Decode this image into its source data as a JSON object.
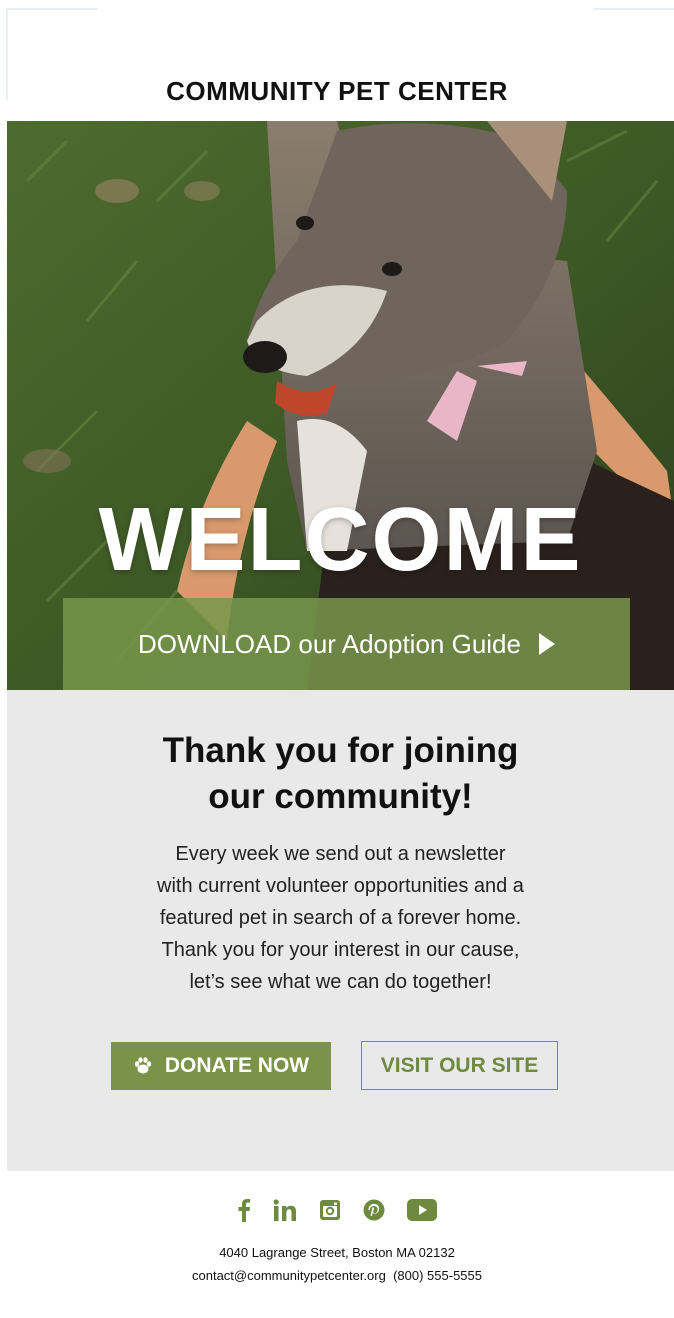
{
  "brand": {
    "title": "COMMUNITY PET CENTER"
  },
  "hero": {
    "welcome_text": "WELCOME",
    "download_text": "DOWNLOAD our Adoption Guide"
  },
  "content": {
    "headline_line1": "Thank you for joining",
    "headline_line2": "our community!",
    "body_lines": [
      "Every week we send out a newsletter",
      "with current volunteer opportunities and a",
      "featured pet in search of a forever home.",
      "Thank you for your interest in our cause,",
      "let’s see what we can do together!"
    ],
    "donate_label": "DONATE NOW",
    "visit_label": "VISIT OUR SITE"
  },
  "social": {
    "icons": [
      "facebook-icon",
      "linkedin-icon",
      "instagram-icon",
      "pinterest-icon",
      "youtube-icon"
    ]
  },
  "footer": {
    "address": "4040 Lagrange Street, Boston MA 02132",
    "email": "contact@communitypetcenter.org",
    "phone": "(800) 555-5555"
  },
  "colors": {
    "accent": "#7a9348",
    "panel": "#e9e9e9"
  }
}
